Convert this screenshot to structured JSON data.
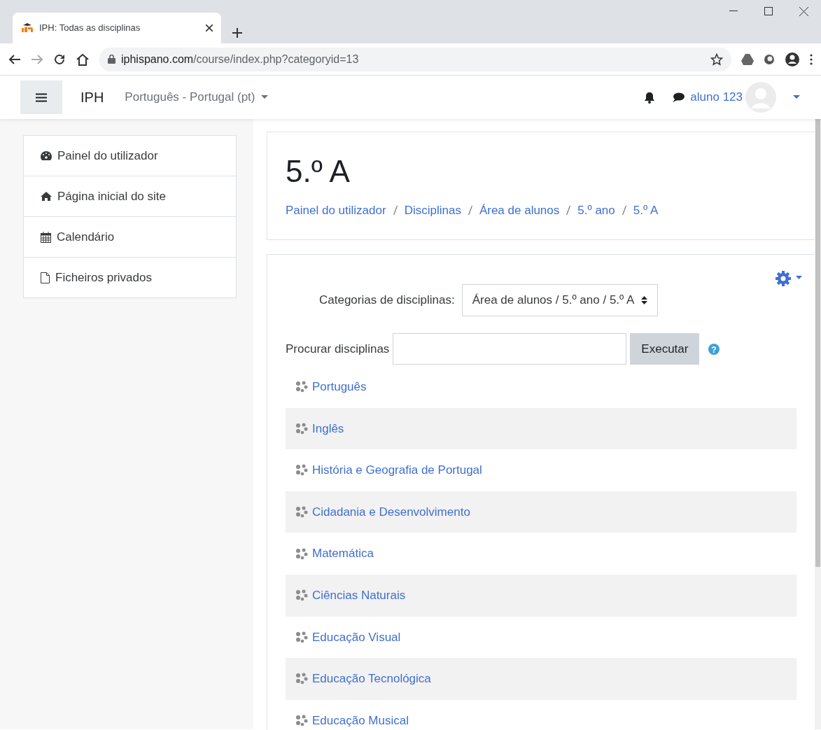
{
  "browser": {
    "tab_title": "IPH: Todas as disciplinas",
    "url_domain": "iphispano.com",
    "url_path": "/course/index.php?categoryid=13"
  },
  "navbar": {
    "brand": "IPH",
    "language": "Português - Portugal (pt)",
    "user": "aluno 123"
  },
  "sidebar": {
    "items": [
      {
        "label": "Painel do utilizador",
        "kind": "dashboard"
      },
      {
        "label": "Página inicial do site",
        "kind": "home"
      },
      {
        "label": "Calendário",
        "kind": "calendar"
      },
      {
        "label": "Ficheiros privados",
        "kind": "file"
      }
    ]
  },
  "header": {
    "title": "5.º A",
    "breadcrumb": [
      "Painel do utilizador",
      "Disciplinas",
      "Área de alunos",
      "5.º ano",
      "5.º A"
    ]
  },
  "category": {
    "label": "Categorias de disciplinas:",
    "value": "Área de alunos / 5.º ano / 5.º A"
  },
  "search": {
    "label": "Procurar disciplinas",
    "button": "Executar",
    "help": "?"
  },
  "courses": [
    "Português",
    "Inglês",
    "História e Geografia de Portugal",
    "Cidadania e Desenvolvimento",
    "Matemática",
    "Ciências Naturais",
    "Educação Visual",
    "Educação Tecnológica",
    "Educação Musical"
  ]
}
